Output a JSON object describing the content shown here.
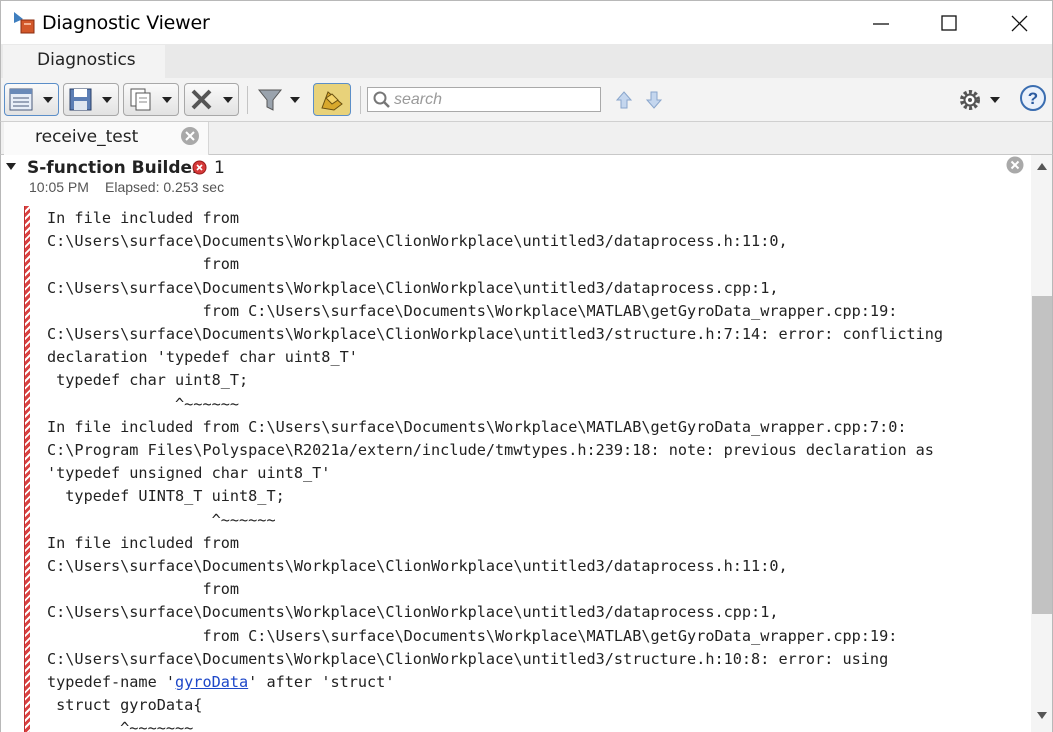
{
  "window": {
    "title": "Diagnostic Viewer",
    "icon": "simulink-diagnostic-icon"
  },
  "ribbon": {
    "tab_label": "Diagnostics"
  },
  "toolbar": {
    "search_placeholder": "search",
    "icons": [
      "expand-collapse-icon",
      "save-icon",
      "copy-icon",
      "clear-icon",
      "filter-icon",
      "highlight-icon",
      "search-icon",
      "previous-arrow-icon",
      "next-arrow-icon",
      "gear-icon",
      "help-icon"
    ]
  },
  "doc_tab": {
    "label": "receive_test"
  },
  "group": {
    "title": "S-function Builder",
    "error_count": "1",
    "time": "10:05 PM",
    "elapsed": "Elapsed: 0.253 sec"
  },
  "log": {
    "lines": [
      "In file included from",
      "C:\\Users\\surface\\Documents\\Workplace\\ClionWorkplace\\untitled3/dataprocess.h:11:0,",
      "                 from",
      "C:\\Users\\surface\\Documents\\Workplace\\ClionWorkplace\\untitled3/dataprocess.cpp:1,",
      "                 from C:\\Users\\surface\\Documents\\Workplace\\MATLAB\\getGyroData_wrapper.cpp:19:",
      "C:\\Users\\surface\\Documents\\Workplace\\ClionWorkplace\\untitled3/structure.h:7:14: error: conflicting",
      "declaration 'typedef char uint8_T'",
      " typedef char uint8_T;",
      "              ^~~~~~~",
      "In file included from C:\\Users\\surface\\Documents\\Workplace\\MATLAB\\getGyroData_wrapper.cpp:7:0:",
      "C:\\Program Files\\Polyspace\\R2021a/extern/include/tmwtypes.h:239:18: note: previous declaration as",
      "'typedef unsigned char uint8_T'",
      "  typedef UINT8_T uint8_T;",
      "                  ^~~~~~~",
      "In file included from",
      "C:\\Users\\surface\\Documents\\Workplace\\ClionWorkplace\\untitled3/dataprocess.h:11:0,",
      "                 from",
      "C:\\Users\\surface\\Documents\\Workplace\\ClionWorkplace\\untitled3/dataprocess.cpp:1,",
      "                 from C:\\Users\\surface\\Documents\\Workplace\\MATLAB\\getGyroData_wrapper.cpp:19:",
      "C:\\Users\\surface\\Documents\\Workplace\\ClionWorkplace\\untitled3/structure.h:10:8: error: using"
    ],
    "link_line_before": "typedef-name '",
    "link_text": "gyroData",
    "link_line_after": "' after 'struct'",
    "tail_lines": [
      " struct gyroData{",
      "        ^~~~~~~~"
    ]
  },
  "colors": {
    "error_red": "#d94040",
    "link_blue": "#1d47c8",
    "active_border": "#5b8ec8"
  }
}
